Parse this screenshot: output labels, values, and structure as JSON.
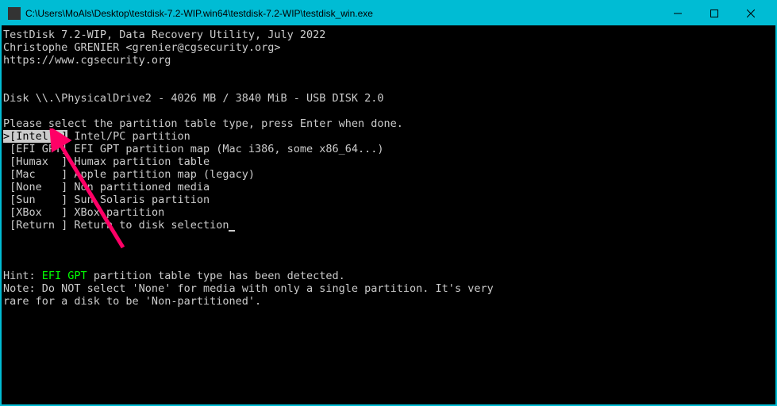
{
  "window": {
    "title": "C:\\Users\\MoAls\\Desktop\\testdisk-7.2-WIP.win64\\testdisk-7.2-WIP\\testdisk_win.exe"
  },
  "header": {
    "line1": "TestDisk 7.2-WIP, Data Recovery Utility, July 2022",
    "line2": "Christophe GRENIER <grenier@cgsecurity.org>",
    "line3": "https://www.cgsecurity.org"
  },
  "disk": "Disk \\\\.\\PhysicalDrive2 - 4026 MB / 3840 MiB - USB DISK 2.0",
  "prompt": "Please select the partition table type, press Enter when done.",
  "options": [
    {
      "key": ">[Intel  ]",
      "desc": " Intel/PC partition",
      "selected": true
    },
    {
      "key": " [EFI GPT]",
      "desc": " EFI GPT partition map (Mac i386, some x86_64...)",
      "selected": false
    },
    {
      "key": " [Humax  ]",
      "desc": " Humax partition table",
      "selected": false
    },
    {
      "key": " [Mac    ]",
      "desc": " Apple partition map (legacy)",
      "selected": false
    },
    {
      "key": " [None   ]",
      "desc": " Non partitioned media",
      "selected": false
    },
    {
      "key": " [Sun    ]",
      "desc": " Sun Solaris partition",
      "selected": false
    },
    {
      "key": " [XBox   ]",
      "desc": " XBox partition",
      "selected": false
    },
    {
      "key": " [Return ]",
      "desc": " Return to disk selection",
      "selected": false
    }
  ],
  "hint": {
    "prefix": "Hint: ",
    "detected": "EFI GPT",
    "suffix": " partition table type has been detected."
  },
  "note": "Note: Do NOT select 'None' for media with only a single partition. It's very\nrare for a disk to be 'Non-partitioned'."
}
